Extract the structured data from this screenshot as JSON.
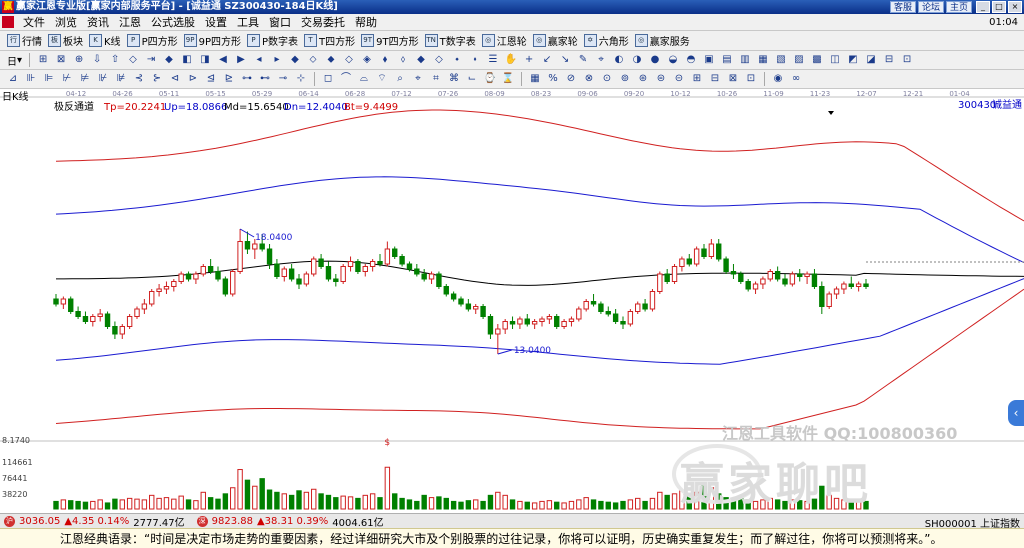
{
  "window": {
    "title": "赢家江恩专业版[赢家内部服务平台] - [诚益通   SZ300430-184日K线]",
    "app_icon_text": "赢",
    "links": [
      "客服",
      "论坛",
      "主页"
    ],
    "controls": {
      "minimize": "_",
      "maximize": "□",
      "close": "×"
    }
  },
  "menu": {
    "items": [
      "文件",
      "浏览",
      "资讯",
      "江恩",
      "公式选股",
      "设置",
      "工具",
      "窗口",
      "交易委托",
      "帮助"
    ],
    "time": "01:04"
  },
  "toolbar1": {
    "items": [
      {
        "icon": "行",
        "label": "行情"
      },
      {
        "icon": "板",
        "label": "板块"
      },
      {
        "icon": "K",
        "label": "K线"
      },
      {
        "icon": "P",
        "label": "P四方形"
      },
      {
        "icon": "9P",
        "label": "9P四方形"
      },
      {
        "icon": "P",
        "label": "P数字表"
      },
      {
        "icon": "T",
        "label": "T四方形"
      },
      {
        "icon": "9T",
        "label": "9T四方形"
      },
      {
        "icon": "TN",
        "label": "T数字表"
      },
      {
        "icon": "◎",
        "label": "江恩轮"
      },
      {
        "icon": "◎",
        "label": "赢家轮"
      },
      {
        "icon": "✡",
        "label": "六角形"
      },
      {
        "icon": "◎",
        "label": "赢家服务"
      }
    ]
  },
  "toolbar2": {
    "dropdown_label": "日",
    "glyphs": [
      "⊞",
      "⊠",
      "⊕",
      "⇩",
      "⇧",
      "◇",
      "⇥",
      "◆",
      "◧",
      "◨",
      "◀",
      "▶",
      "◂",
      "▸",
      "◆",
      "⬦",
      "⬥",
      "◇",
      "◈",
      "⬧",
      "⬨",
      "◆",
      "◇",
      "⬩",
      "⬪",
      "☰",
      "✋",
      "+",
      "↙",
      "↘",
      "✎",
      "⌖",
      "◐",
      "◑",
      "●",
      "◒",
      "◓",
      "▣",
      "▤",
      "▥",
      "▦",
      "▧",
      "▨",
      "▩",
      "◫",
      "◩",
      "◪",
      "⊟",
      "⊡"
    ]
  },
  "toolbar3": {
    "glyphs": [
      "⊿",
      "⊪",
      "⊫",
      "⊬",
      "⊭",
      "⊮",
      "⊯",
      "⊰",
      "⊱",
      "⊲",
      "⊳",
      "⊴",
      "⊵",
      "⊶",
      "⊷",
      "⊸",
      "⊹",
      "|",
      "◻",
      "⌒",
      "⌓",
      "⌔",
      "⌕",
      "⌖",
      "⌗",
      "⌘",
      "⌙",
      "⌚",
      "⌛",
      "|",
      "▦",
      "%",
      "⊘",
      "⊗",
      "⊙",
      "⊚",
      "⊛",
      "⊜",
      "⊝",
      "⊞",
      "⊟",
      "⊠",
      "⊡",
      "|",
      "◉",
      "∞"
    ]
  },
  "chart": {
    "period_label": "日K线",
    "indicator_name": "极反通道",
    "tp": "Tp=20.2241",
    "up": "Up=18.0866",
    "md": "Md=15.6540",
    "dn": "Dn=12.4040",
    "bt": "Bt=9.4499",
    "code": "300430",
    "name": "诚益通",
    "high_label": "18.0400",
    "low_label": "13.0400",
    "dates": [
      "04-12",
      "04-26",
      "05-11",
      "05-15",
      "05-29",
      "06-14",
      "06-28",
      "07-12",
      "07-26",
      "08-09",
      "08-23",
      "09-06",
      "09-20",
      "10-12",
      "10-26",
      "11-09",
      "11-23",
      "12-07",
      "12-21",
      "01-04"
    ],
    "volume_labels": [
      "8.1740",
      "114661",
      "76441",
      "38220"
    ],
    "volume_marker": "$"
  },
  "chart_data": {
    "type": "candlestick",
    "price_candles": [
      [
        15.2,
        15.4,
        14.9,
        15.0
      ],
      [
        15.0,
        15.3,
        14.8,
        15.2
      ],
      [
        15.2,
        15.3,
        14.6,
        14.7
      ],
      [
        14.7,
        14.9,
        14.4,
        14.5
      ],
      [
        14.5,
        14.7,
        14.2,
        14.3
      ],
      [
        14.3,
        14.6,
        14.1,
        14.5
      ],
      [
        14.5,
        14.8,
        14.3,
        14.6
      ],
      [
        14.6,
        14.7,
        14.0,
        14.1
      ],
      [
        14.1,
        14.3,
        13.6,
        13.8
      ],
      [
        13.8,
        14.2,
        13.6,
        14.1
      ],
      [
        14.1,
        14.6,
        14.0,
        14.5
      ],
      [
        14.5,
        14.9,
        14.4,
        14.8
      ],
      [
        14.8,
        15.2,
        14.6,
        15.0
      ],
      [
        15.0,
        15.6,
        14.9,
        15.5
      ],
      [
        15.5,
        15.8,
        15.3,
        15.6
      ],
      [
        15.6,
        15.9,
        15.4,
        15.7
      ],
      [
        15.7,
        16.0,
        15.5,
        15.9
      ],
      [
        15.9,
        16.3,
        15.8,
        16.2
      ],
      [
        16.2,
        16.3,
        15.9,
        16.0
      ],
      [
        16.0,
        16.3,
        15.8,
        16.2
      ],
      [
        16.2,
        16.6,
        16.1,
        16.5
      ],
      [
        16.5,
        16.8,
        16.2,
        16.3
      ],
      [
        16.3,
        16.5,
        15.9,
        16.0
      ],
      [
        16.0,
        16.1,
        15.3,
        15.4
      ],
      [
        15.4,
        16.4,
        15.3,
        16.3
      ],
      [
        16.3,
        18.0,
        16.2,
        17.5
      ],
      [
        17.5,
        17.9,
        17.0,
        17.2
      ],
      [
        17.2,
        17.6,
        16.8,
        17.4
      ],
      [
        17.4,
        17.8,
        17.1,
        17.2
      ],
      [
        17.2,
        17.4,
        16.4,
        16.6
      ],
      [
        16.6,
        16.8,
        16.0,
        16.1
      ],
      [
        16.1,
        16.5,
        15.9,
        16.4
      ],
      [
        16.4,
        16.6,
        15.9,
        16.0
      ],
      [
        16.0,
        16.2,
        15.6,
        15.8
      ],
      [
        15.8,
        16.3,
        15.7,
        16.2
      ],
      [
        16.2,
        16.9,
        16.1,
        16.8
      ],
      [
        16.8,
        17.0,
        16.4,
        16.5
      ],
      [
        16.5,
        16.7,
        15.9,
        16.0
      ],
      [
        16.0,
        16.2,
        15.7,
        15.9
      ],
      [
        15.9,
        16.6,
        15.8,
        16.5
      ],
      [
        16.5,
        16.9,
        16.3,
        16.7
      ],
      [
        16.7,
        16.8,
        16.2,
        16.3
      ],
      [
        16.3,
        16.6,
        16.1,
        16.5
      ],
      [
        16.5,
        16.8,
        16.3,
        16.7
      ],
      [
        16.7,
        17.0,
        16.5,
        16.6
      ],
      [
        16.6,
        17.5,
        16.5,
        17.2
      ],
      [
        17.2,
        17.3,
        16.8,
        16.9
      ],
      [
        16.9,
        17.0,
        16.5,
        16.6
      ],
      [
        16.6,
        16.7,
        16.3,
        16.4
      ],
      [
        16.4,
        16.6,
        16.1,
        16.2
      ],
      [
        16.2,
        16.4,
        15.9,
        16.0
      ],
      [
        16.0,
        16.3,
        15.8,
        16.2
      ],
      [
        16.2,
        16.3,
        15.6,
        15.7
      ],
      [
        15.7,
        15.8,
        15.3,
        15.4
      ],
      [
        15.4,
        15.5,
        15.1,
        15.2
      ],
      [
        15.2,
        15.3,
        14.9,
        15.0
      ],
      [
        15.0,
        15.2,
        14.7,
        14.8
      ],
      [
        14.8,
        15.0,
        14.6,
        14.9
      ],
      [
        14.9,
        15.0,
        14.4,
        14.5
      ],
      [
        14.5,
        14.6,
        13.6,
        13.8
      ],
      [
        13.8,
        14.2,
        13.0,
        14.0
      ],
      [
        14.0,
        14.4,
        13.8,
        14.3
      ],
      [
        14.3,
        14.5,
        14.0,
        14.2
      ],
      [
        14.2,
        14.5,
        14.0,
        14.4
      ],
      [
        14.4,
        14.6,
        14.1,
        14.2
      ],
      [
        14.2,
        14.4,
        14.0,
        14.3
      ],
      [
        14.3,
        14.5,
        14.1,
        14.4
      ],
      [
        14.4,
        14.6,
        14.2,
        14.5
      ],
      [
        14.5,
        14.6,
        14.0,
        14.1
      ],
      [
        14.1,
        14.4,
        14.0,
        14.3
      ],
      [
        14.3,
        14.5,
        14.1,
        14.4
      ],
      [
        14.4,
        14.9,
        14.3,
        14.8
      ],
      [
        14.8,
        15.2,
        14.7,
        15.1
      ],
      [
        15.1,
        15.4,
        14.9,
        15.0
      ],
      [
        15.0,
        15.1,
        14.6,
        14.7
      ],
      [
        14.7,
        14.9,
        14.5,
        14.6
      ],
      [
        14.6,
        14.8,
        14.2,
        14.3
      ],
      [
        14.3,
        14.5,
        14.0,
        14.2
      ],
      [
        14.2,
        14.8,
        14.1,
        14.7
      ],
      [
        14.7,
        15.1,
        14.6,
        15.0
      ],
      [
        15.0,
        15.2,
        14.7,
        14.8
      ],
      [
        14.8,
        15.6,
        14.7,
        15.5
      ],
      [
        15.5,
        16.3,
        15.4,
        16.2
      ],
      [
        16.2,
        16.4,
        15.8,
        15.9
      ],
      [
        15.9,
        16.6,
        15.8,
        16.5
      ],
      [
        16.5,
        16.9,
        16.3,
        16.8
      ],
      [
        16.8,
        17.0,
        16.5,
        16.6
      ],
      [
        16.6,
        17.3,
        16.5,
        17.2
      ],
      [
        17.2,
        17.4,
        16.8,
        16.9
      ],
      [
        16.9,
        17.6,
        16.8,
        17.4
      ],
      [
        17.4,
        17.6,
        16.7,
        16.8
      ],
      [
        16.8,
        16.9,
        16.2,
        16.3
      ],
      [
        16.3,
        16.6,
        16.0,
        16.2
      ],
      [
        16.2,
        16.3,
        15.8,
        15.9
      ],
      [
        15.9,
        16.0,
        15.5,
        15.6
      ],
      [
        15.6,
        15.9,
        15.4,
        15.8
      ],
      [
        15.8,
        16.1,
        15.6,
        16.0
      ],
      [
        16.0,
        16.4,
        15.9,
        16.3
      ],
      [
        16.3,
        16.5,
        15.9,
        16.0
      ],
      [
        16.0,
        16.2,
        15.7,
        15.8
      ],
      [
        15.8,
        16.3,
        15.7,
        16.2
      ],
      [
        16.2,
        16.4,
        15.9,
        16.1
      ],
      [
        16.1,
        16.3,
        15.8,
        16.2
      ],
      [
        16.2,
        16.4,
        15.6,
        15.7
      ],
      [
        15.7,
        15.9,
        14.6,
        14.9
      ],
      [
        14.9,
        15.5,
        14.8,
        15.4
      ],
      [
        15.4,
        15.7,
        15.2,
        15.6
      ],
      [
        15.6,
        15.9,
        15.4,
        15.8
      ],
      [
        15.8,
        16.1,
        15.6,
        15.7
      ],
      [
        15.7,
        15.9,
        15.5,
        15.8
      ],
      [
        15.8,
        16.0,
        15.6,
        15.7
      ]
    ],
    "volumes": [
      0.1,
      0.12,
      0.11,
      0.1,
      0.09,
      0.1,
      0.12,
      0.08,
      0.13,
      0.12,
      0.14,
      0.13,
      0.12,
      0.18,
      0.14,
      0.15,
      0.13,
      0.17,
      0.12,
      0.11,
      0.22,
      0.15,
      0.13,
      0.2,
      0.28,
      0.52,
      0.38,
      0.3,
      0.4,
      0.25,
      0.22,
      0.2,
      0.18,
      0.24,
      0.22,
      0.26,
      0.2,
      0.18,
      0.15,
      0.17,
      0.16,
      0.14,
      0.18,
      0.2,
      0.15,
      0.55,
      0.2,
      0.14,
      0.12,
      0.1,
      0.18,
      0.15,
      0.16,
      0.14,
      0.1,
      0.09,
      0.11,
      0.12,
      0.1,
      0.18,
      0.22,
      0.18,
      0.12,
      0.1,
      0.09,
      0.08,
      0.1,
      0.11,
      0.09,
      0.08,
      0.1,
      0.12,
      0.15,
      0.12,
      0.1,
      0.09,
      0.08,
      0.1,
      0.12,
      0.14,
      0.1,
      0.14,
      0.22,
      0.18,
      0.2,
      0.24,
      0.18,
      0.22,
      0.3,
      0.28,
      0.2,
      0.15,
      0.14,
      0.16,
      0.12,
      0.1,
      0.12,
      0.14,
      0.12,
      0.1,
      0.12,
      0.11,
      0.1,
      0.13,
      0.3,
      0.18,
      0.14,
      0.12,
      0.1,
      0.11,
      0.1
    ]
  },
  "status": {
    "sh_value": "3036.05",
    "sh_change": "▲4.35 0.14%",
    "sh_amount": "2777.47亿",
    "sz_value": "9823.88",
    "sz_change": "▲38.31 0.39%",
    "sz_amount": "4004.61亿",
    "right_text": "SH000001 上证指数",
    "icon1": "沪",
    "icon2": "深"
  },
  "quote": {
    "text": "江恩经典语录：“时间是决定市场走势的重要因素，经过详细研究大市及个别股票的过往记录，你将可以证明，历史确实重复发生；而了解过往，你将可以预测将来。”。"
  },
  "watermark": {
    "line1": "江恩工具软件  QQ:100800360",
    "line2": "赢家聊吧"
  }
}
